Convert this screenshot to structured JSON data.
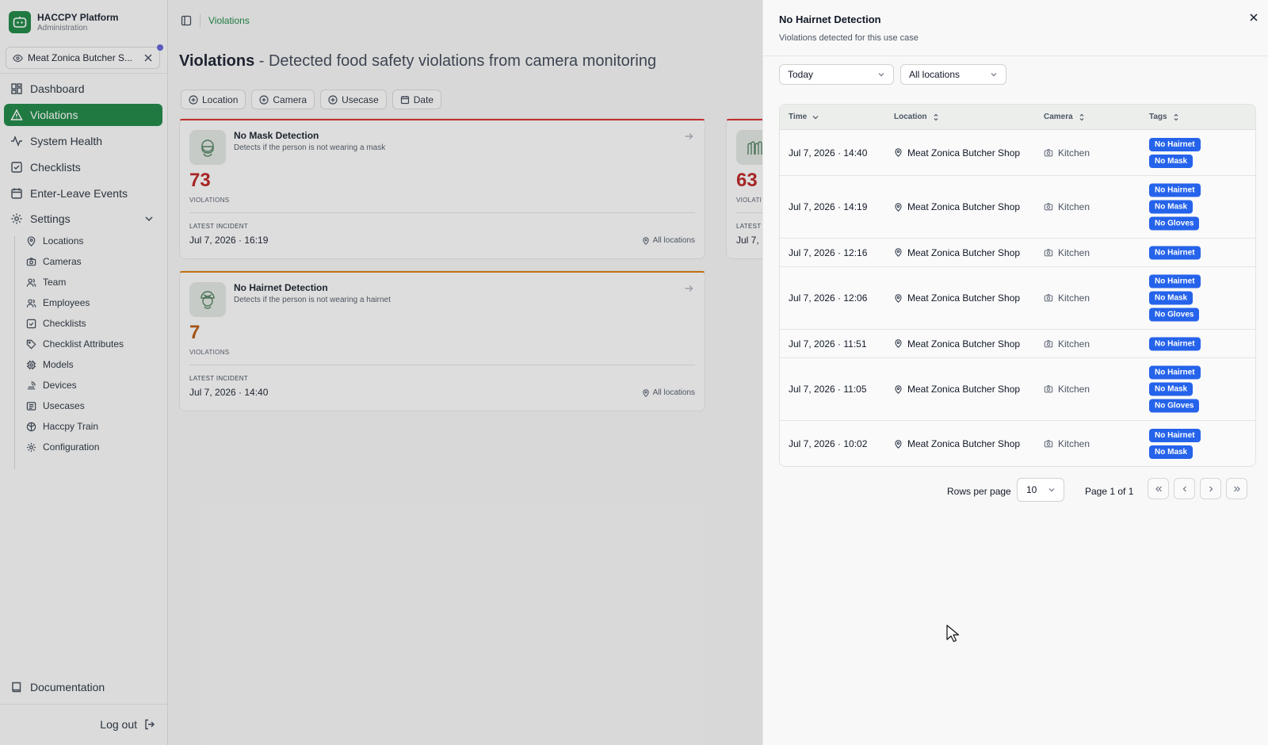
{
  "brand": {
    "title": "HACCPY Platform",
    "subtitle": "Administration"
  },
  "shop_selector": {
    "label": "Meat Zonica Butcher S..."
  },
  "nav": {
    "dashboard": "Dashboard",
    "violations": "Violations",
    "system_health": "System Health",
    "checklists": "Checklists",
    "enter_leave": "Enter-Leave Events",
    "settings": "Settings",
    "settings_items": [
      "Locations",
      "Cameras",
      "Team",
      "Employees",
      "Checklists",
      "Checklist Attributes",
      "Models",
      "Devices",
      "Usecases",
      "Haccpy Train",
      "Configuration"
    ],
    "documentation": "Documentation",
    "logout": "Log out"
  },
  "breadcrumb": {
    "current": "Violations"
  },
  "page": {
    "title": "Violations",
    "subtitle": " - Detected food safety violations from camera monitoring"
  },
  "filters": [
    "Location",
    "Camera",
    "Usecase",
    "Date"
  ],
  "cards": [
    {
      "title": "No Mask Detection",
      "description": "Detects if the person is not wearing a mask",
      "count": "73",
      "count_label": "VIOLATIONS",
      "incident_label": "LATEST INCIDENT",
      "incident_date": "Jul 7, 2026 · 16:19",
      "location": "All locations",
      "accent": "#dc2626"
    },
    {
      "title": "No Hairnet Detection",
      "description": "Detects if the person is not wearing a hairnet",
      "count": "7",
      "count_label": "VIOLATIONS",
      "incident_label": "LATEST INCIDENT",
      "incident_date": "Jul 7, 2026 · 14:40",
      "location": "All locations",
      "accent": "#d97706"
    },
    {
      "count": "63",
      "count_label": "VIOLATI",
      "incident_label": "LATEST",
      "incident_date": "Jul 7, :"
    }
  ],
  "panel": {
    "title": "No Hairnet Detection",
    "subtitle": "Violations detected for this use case",
    "period": "Today",
    "location": "All locations",
    "columns": {
      "time": "Time",
      "location": "Location",
      "camera": "Camera",
      "tags": "Tags"
    },
    "rows": [
      {
        "time": "Jul 7, 2026 · 14:40",
        "location": "Meat Zonica Butcher Shop",
        "camera": "Kitchen",
        "tags": [
          "No Hairnet",
          "No Mask"
        ]
      },
      {
        "time": "Jul 7, 2026 · 14:19",
        "location": "Meat Zonica Butcher Shop",
        "camera": "Kitchen",
        "tags": [
          "No Hairnet",
          "No Mask",
          "No Gloves"
        ]
      },
      {
        "time": "Jul 7, 2026 · 12:16",
        "location": "Meat Zonica Butcher Shop",
        "camera": "Kitchen",
        "tags": [
          "No Hairnet"
        ]
      },
      {
        "time": "Jul 7, 2026 · 12:06",
        "location": "Meat Zonica Butcher Shop",
        "camera": "Kitchen",
        "tags": [
          "No Hairnet",
          "No Mask",
          "No Gloves"
        ]
      },
      {
        "time": "Jul 7, 2026 · 11:51",
        "location": "Meat Zonica Butcher Shop",
        "camera": "Kitchen",
        "tags": [
          "No Hairnet"
        ]
      },
      {
        "time": "Jul 7, 2026 · 11:05",
        "location": "Meat Zonica Butcher Shop",
        "camera": "Kitchen",
        "tags": [
          "No Hairnet",
          "No Mask",
          "No Gloves"
        ]
      },
      {
        "time": "Jul 7, 2026 · 10:02",
        "location": "Meat Zonica Butcher Shop",
        "camera": "Kitchen",
        "tags": [
          "No Hairnet",
          "No Mask"
        ]
      }
    ],
    "pagination": {
      "rows_per_page_label": "Rows per page",
      "rows_per_page": "10",
      "page_info": "Page 1 of 1"
    }
  },
  "colors": {
    "brand_green": "#15803d",
    "tag_blue": "#2563eb",
    "danger": "#b91c1c",
    "warning": "#b45309"
  }
}
